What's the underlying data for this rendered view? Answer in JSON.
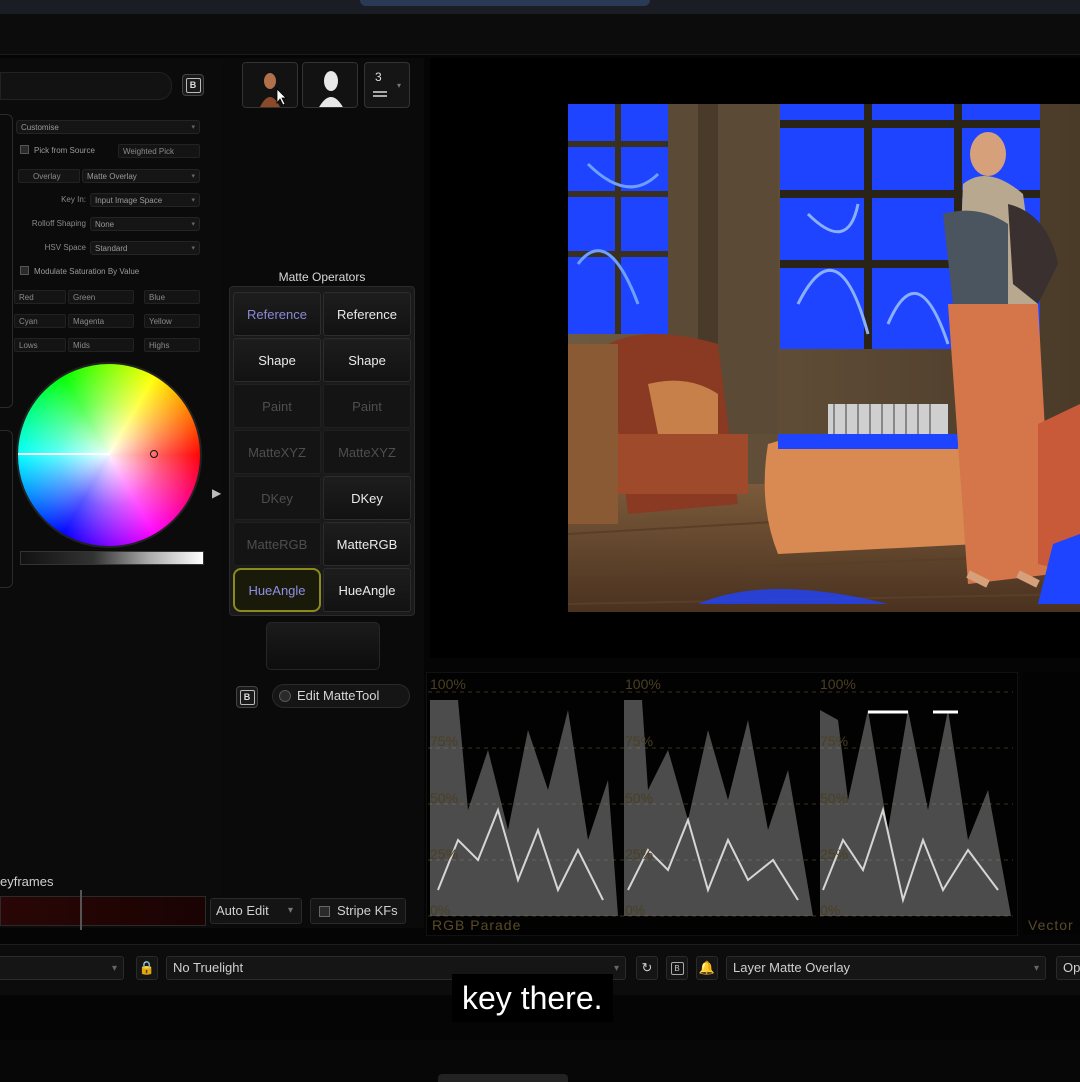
{
  "left_panel": {
    "customise": "Customise",
    "pick_from_source": "Pick from Source",
    "weighted_pick": "Weighted Pick",
    "overlay_label": "Overlay",
    "overlay_value": "Matte Overlay",
    "key_in_label": "Key In:",
    "key_in_value": "Input Image Space",
    "rolloff_label": "Rolloff Shaping",
    "rolloff_value": "None",
    "hsv_label": "HSV Space",
    "hsv_value": "Standard",
    "modulate_sat": "Modulate Saturation By Value",
    "channels": [
      "Red",
      "Green",
      "Blue",
      "Cyan",
      "Magenta",
      "Yellow",
      "Lows",
      "Mids",
      "Highs"
    ]
  },
  "thumbs": {
    "count": "3"
  },
  "matte_operators": {
    "title": "Matte Operators",
    "rows": [
      [
        "Reference",
        "Reference"
      ],
      [
        "Shape",
        "Shape"
      ],
      [
        "Paint",
        "Paint"
      ],
      [
        "MatteXYZ",
        "MatteXYZ"
      ],
      [
        "DKey",
        "DKey"
      ],
      [
        "MatteRGB",
        "MatteRGB"
      ],
      [
        "HueAngle",
        "HueAngle"
      ]
    ],
    "edit_label": "Edit MatteTool"
  },
  "keyframes": {
    "label": "eyframes",
    "auto_edit": "Auto Edit",
    "stripe": "Stripe KFs"
  },
  "scopes": {
    "pct_100": "100%",
    "pct_75": "75%",
    "pct_50": "50%",
    "pct_25": "25%",
    "pct_0": "0%",
    "parade_label": "RGB Parade",
    "vector_label": "Vector"
  },
  "bottom": {
    "truelight": "No Truelight",
    "layer_overlay": "Layer Matte Overlay",
    "op_label": "Op"
  },
  "caption": "key there.",
  "colors": {
    "accent_select": "#8b8b1c",
    "key_blue": "#1f44ff"
  }
}
